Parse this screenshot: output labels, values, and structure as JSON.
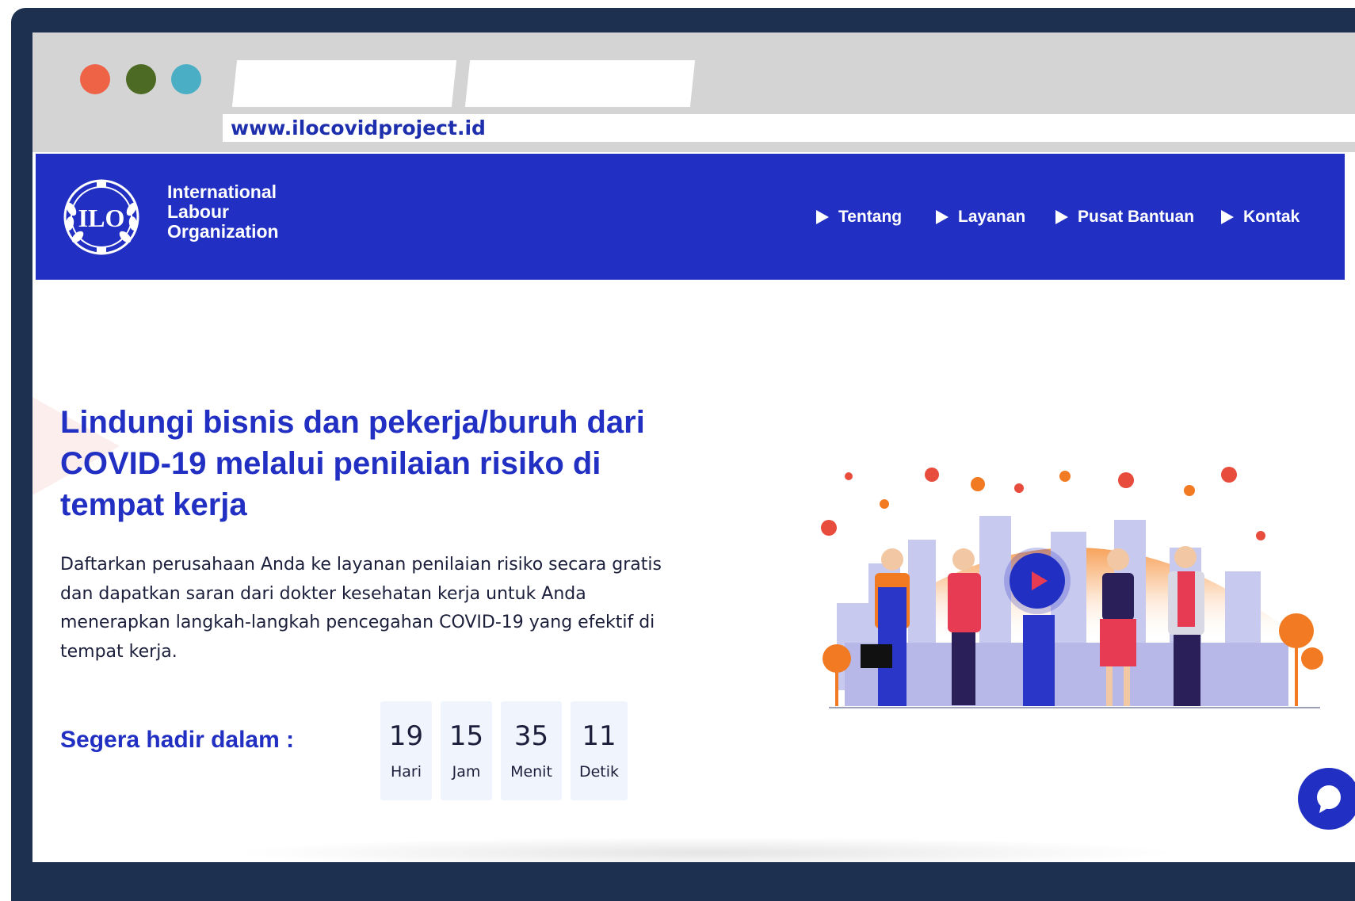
{
  "browser": {
    "url": "www.ilocovidproject.id",
    "tabs": [
      "",
      ""
    ],
    "window_dots": {
      "close": "#ee6246",
      "minimize": "#4c6a23",
      "maximize": "#4aafc5"
    }
  },
  "header": {
    "logo_lines": [
      "International",
      "Labour",
      "Organization"
    ],
    "emblem_text": "ILO",
    "nav": [
      {
        "label": "Tentang"
      },
      {
        "label": "Layanan"
      },
      {
        "label": "Pusat Bantuan"
      },
      {
        "label": "Kontak"
      }
    ],
    "brand_color": "#2130c3"
  },
  "hero": {
    "title": "Lindungi bisnis dan pekerja/buruh dari COVID-19 melalui penilaian risiko di tempat kerja",
    "description": "Daftarkan perusahaan Anda ke layanan penilaian risiko secara gratis dan dapatkan saran dari dokter kesehatan kerja untuk Anda menerapkan langkah-langkah pencegahan COVID-19 yang efektif di tempat kerja.",
    "countdown_label": "Segera hadir dalam :",
    "countdown": [
      {
        "value": "19",
        "unit": "Hari"
      },
      {
        "value": "15",
        "unit": "Jam"
      },
      {
        "value": "35",
        "unit": "Menit"
      },
      {
        "value": "11",
        "unit": "Detik"
      }
    ]
  },
  "icons": {
    "play": "play-icon",
    "chat": "chat-icon",
    "nav_arrow": "triangle-right-icon"
  }
}
